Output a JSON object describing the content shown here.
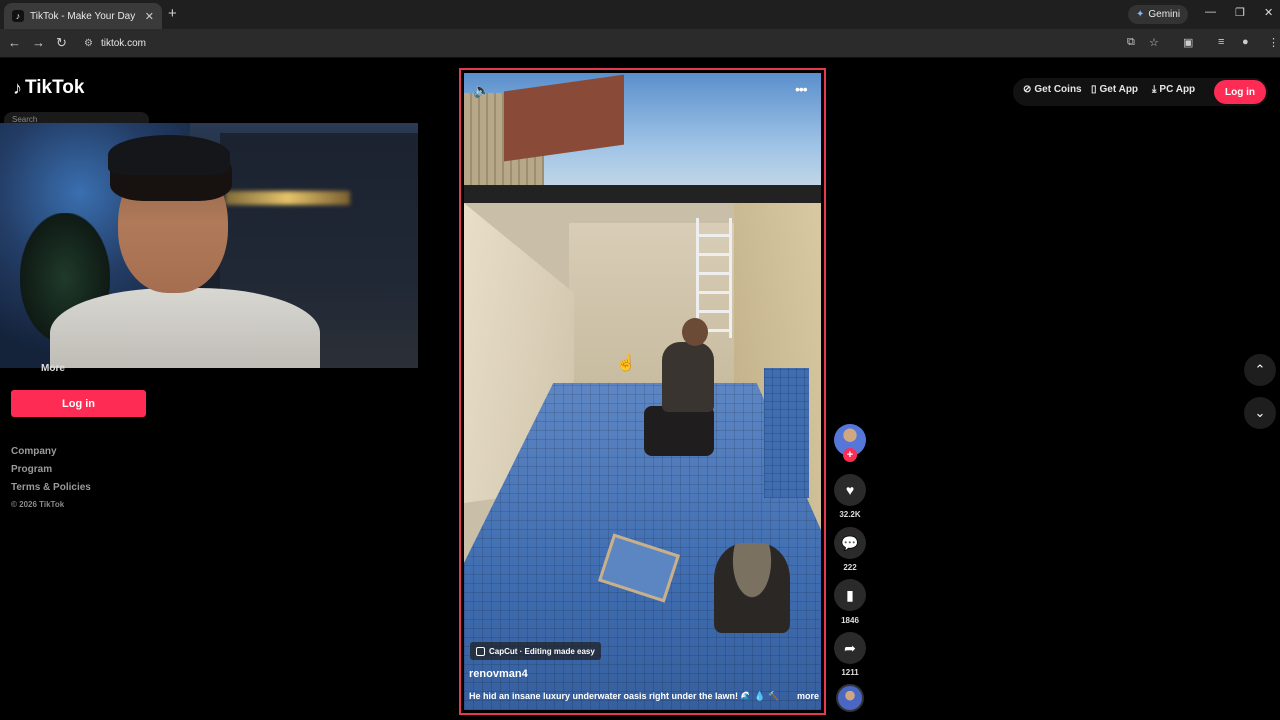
{
  "browser": {
    "tab_title": "TikTok - Make Your Day",
    "tab_favicon": "♪",
    "tab_close": "✕",
    "new_tab": "+",
    "gemini_label": "Gemini",
    "url": "tiktok.com",
    "window_controls": {
      "minimize": "—",
      "restore": "❐",
      "close": "✕"
    }
  },
  "sidebar": {
    "logo_text": "TikTok",
    "logo_note": "♪",
    "search_placeholder": "Search",
    "more_label": "More",
    "login_label": "Log in",
    "footer_links": [
      "Company",
      "Program",
      "Terms & Policies"
    ],
    "copyright": "© 2026 TikTok"
  },
  "header": {
    "get_coins": "Get Coins",
    "get_app": "Get App",
    "pc_app": "PC App",
    "login_label": "Log in"
  },
  "video": {
    "capcut_label": "CapCut · Editing made easy",
    "author": "renovman4",
    "caption": "He hid an insane luxury underwater oasis right under the lawn! 🌊 💧 🔨",
    "more_label": "more"
  },
  "actions": {
    "likes": "32.2K",
    "comments": "222",
    "saves": "1846",
    "shares": "1211"
  },
  "colors": {
    "accent": "#fe2c55",
    "video_border": "#e53950"
  }
}
